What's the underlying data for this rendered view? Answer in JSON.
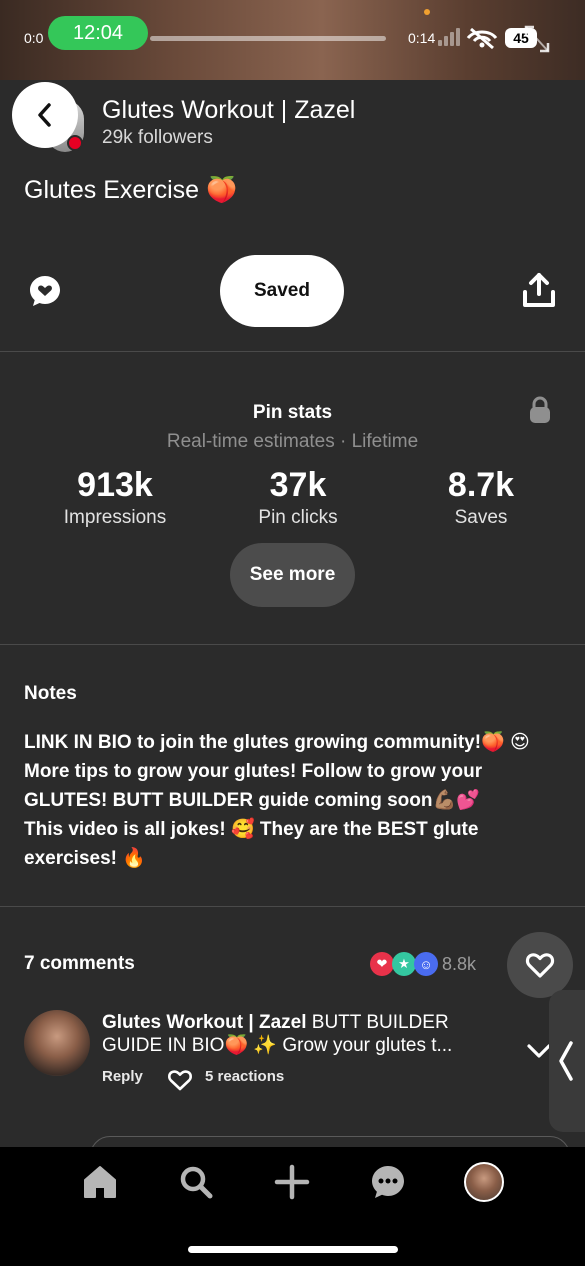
{
  "status_bar": {
    "time_start": "0:0",
    "clock": "12:04",
    "time_end": "0:14",
    "battery": "45"
  },
  "header": {
    "creator_name": "Glutes Workout | Zazel",
    "followers": "29k followers",
    "pin_title": "Glutes Exercise 🍑"
  },
  "actions": {
    "saved_label": "Saved"
  },
  "stats": {
    "title": "Pin stats",
    "subtitle": "Real-time estimates · Lifetime",
    "items": [
      {
        "value": "913k",
        "label": "Impressions"
      },
      {
        "value": "37k",
        "label": "Pin clicks"
      },
      {
        "value": "8.7k",
        "label": "Saves"
      }
    ],
    "see_more_label": "See more"
  },
  "notes": {
    "title": "Notes",
    "lines": [
      "LINK IN BIO to join the glutes growing community!🍑 😍",
      "More tips to grow your glutes! Follow to grow your",
      "GLUTES! BUTT BUILDER guide coming soon💪🏽💕",
      "This video is all jokes! 🥰 They are the BEST glute",
      "exercises! 🔥"
    ]
  },
  "comments": {
    "count_label": "7 comments",
    "reaction_total": "8.8k",
    "first_comment": {
      "author": "Glutes Workout | Zazel",
      "text_line1": " BUTT BUILDER",
      "text_line2": "GUIDE IN BIO🍑 ✨  Grow your glutes t...",
      "reply_label": "Reply",
      "reactions_label": "5 reactions"
    }
  },
  "nav": {
    "items": [
      "home-icon",
      "search-icon",
      "create-icon",
      "messages-icon",
      "profile-avatar"
    ]
  },
  "colors": {
    "background": "#2b2b2b",
    "status_green": "#34c759",
    "brand_red": "#e60023",
    "nav_background": "#000000"
  }
}
